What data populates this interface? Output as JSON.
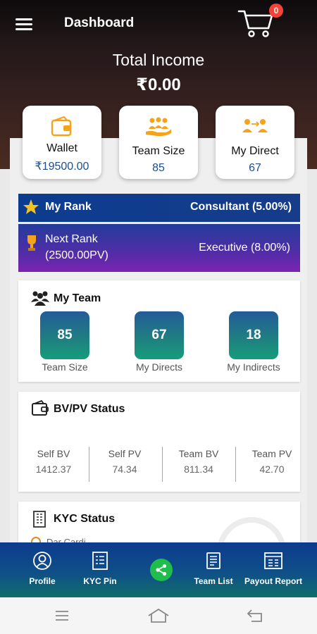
{
  "header": {
    "title": "Dashboard",
    "cart_count": "0"
  },
  "income": {
    "label": "Total Income",
    "value": "₹0.00"
  },
  "stats": [
    {
      "label": "Wallet",
      "value": "₹19500.00",
      "icon": "wallet-icon"
    },
    {
      "label": "Team Size",
      "value": "85",
      "icon": "team-hand-icon"
    },
    {
      "label": "My Direct",
      "value": "67",
      "icon": "direct-link-icon"
    }
  ],
  "rank": {
    "label": "My Rank",
    "value": "Consultant (5.00%)"
  },
  "next_rank": {
    "label_line1": "Next Rank",
    "label_line2": "(2500.00PV)",
    "value": "Executive (8.00%)"
  },
  "my_team": {
    "title": "My Team",
    "items": [
      {
        "value": "85",
        "caption": "Team Size"
      },
      {
        "value": "67",
        "caption": "My Directs"
      },
      {
        "value": "18",
        "caption": "My Indirects"
      }
    ]
  },
  "bvpv": {
    "title": "BV/PV Status",
    "cols": [
      {
        "label": "Self BV",
        "value": "1412.37"
      },
      {
        "label": "Self PV",
        "value": "74.34"
      },
      {
        "label": "Team BV",
        "value": "811.34"
      },
      {
        "label": "Team PV",
        "value": "42.70"
      }
    ]
  },
  "kyc": {
    "title": "KYC Status",
    "partial_text": "Dar Cardi"
  },
  "bottom_nav": [
    {
      "label": "Profile",
      "icon": "profile-icon"
    },
    {
      "label": "KYC Pin",
      "icon": "kyc-pin-icon"
    },
    {
      "label": "",
      "icon": "share-icon"
    },
    {
      "label": "Team List",
      "icon": "team-list-icon"
    },
    {
      "label": "Payout Report",
      "icon": "payout-report-icon"
    }
  ],
  "colors": {
    "primary": "#0d3b8e",
    "accent_purple": "#7a24b0",
    "teal": "#159c7c",
    "share_green": "#1fbd4c",
    "value_blue": "#1d4f8e"
  }
}
